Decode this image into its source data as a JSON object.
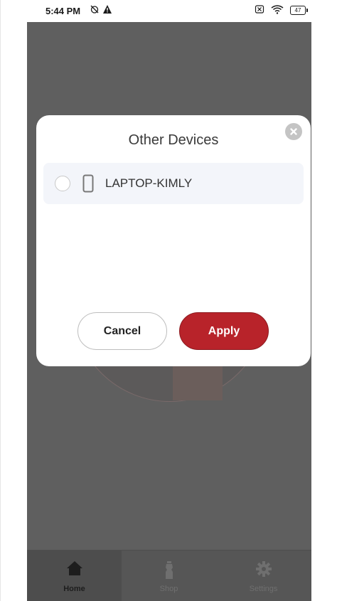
{
  "status_bar": {
    "time": "5:44 PM",
    "battery": "47",
    "icons": [
      "alarm-off-icon",
      "warning-icon",
      "sim-off-icon",
      "wifi-icon",
      "battery-icon"
    ]
  },
  "dialog": {
    "title": "Other Devices",
    "close_icon": "close-icon",
    "devices": [
      {
        "name": "LAPTOP-KIMLY",
        "icon": "phone-icon",
        "selected": false
      }
    ],
    "cancel_label": "Cancel",
    "apply_label": "Apply"
  },
  "bottom_nav": {
    "items": [
      {
        "label": "Home",
        "icon": "home-icon",
        "active": true
      },
      {
        "label": "Shop",
        "icon": "shop-icon",
        "active": false
      },
      {
        "label": "Settings",
        "icon": "gear-icon",
        "active": false
      }
    ]
  },
  "colors": {
    "accent": "#b8232a",
    "overlay": "#5f5f5f"
  }
}
